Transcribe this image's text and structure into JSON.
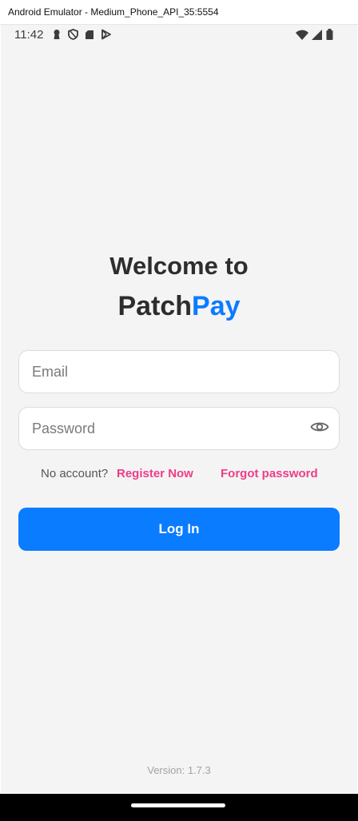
{
  "window": {
    "title": "Android Emulator - Medium_Phone_API_35:5554"
  },
  "status_bar": {
    "time": "11:42",
    "left_icons": [
      "keyhole-icon",
      "shield-icon",
      "sd-card-icon",
      "play-store-icon"
    ],
    "right_icons": [
      "wifi-icon",
      "signal-icon",
      "battery-icon"
    ]
  },
  "login": {
    "title_line1": "Welcome to",
    "brand_part1": "Patch",
    "brand_part2": "Pay",
    "email_placeholder": "Email",
    "password_placeholder": "Password",
    "no_account_text": "No account?",
    "register_label": "Register Now",
    "forgot_label": "Forgot password",
    "login_label": "Log In",
    "version": "Version: 1.7.3"
  },
  "colors": {
    "accent_blue": "#0a7cff",
    "link_pink": "#ef3d86",
    "background": "#f4f4f5",
    "text_dark": "#2d2d2d"
  }
}
